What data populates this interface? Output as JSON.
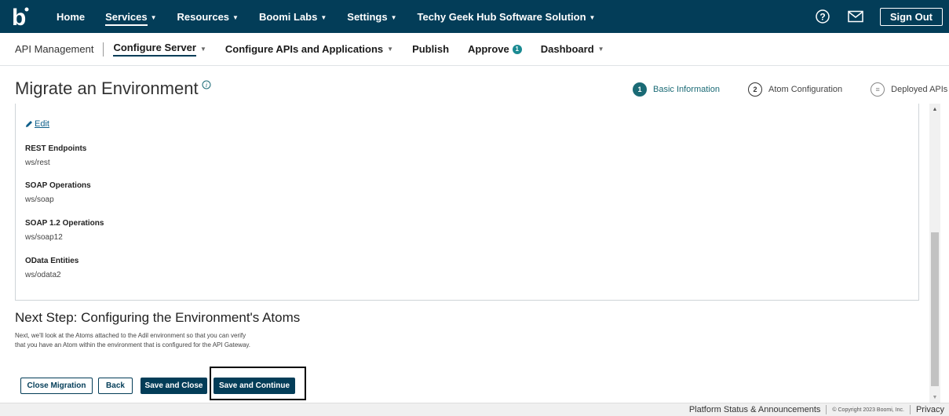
{
  "topnav": {
    "logo": "b",
    "links": [
      {
        "label": "Home",
        "caret": false
      },
      {
        "label": "Services",
        "caret": true
      },
      {
        "label": "Resources",
        "caret": true
      },
      {
        "label": "Boomi Labs",
        "caret": true
      },
      {
        "label": "Settings",
        "caret": true
      },
      {
        "label": "Techy Geek Hub Software Solution",
        "caret": true
      }
    ],
    "sign_out": "Sign Out",
    "icons": [
      "help-icon",
      "mail-icon"
    ]
  },
  "subnav": {
    "title": "API Management",
    "items": [
      {
        "label": "Configure Server",
        "caret": true
      },
      {
        "label": "Configure APIs and Applications",
        "caret": true
      },
      {
        "label": "Publish",
        "caret": false
      },
      {
        "label": "Approve",
        "caret": false,
        "badge": "1"
      },
      {
        "label": "Dashboard",
        "caret": true
      }
    ]
  },
  "page": {
    "title": "Migrate an Environment"
  },
  "steps": [
    {
      "number": "1",
      "label": "Basic Information",
      "state": "active"
    },
    {
      "number": "2",
      "label": "Atom Configuration",
      "state": "pending"
    },
    {
      "number": "≡",
      "label": "Deployed APIs",
      "state": "pending"
    }
  ],
  "panel": {
    "edit_label": "Edit",
    "fields": [
      {
        "label": "REST Endpoints",
        "value": "ws/rest"
      },
      {
        "label": "SOAP Operations",
        "value": "ws/soap"
      },
      {
        "label": "SOAP 1.2 Operations",
        "value": "ws/soap12"
      },
      {
        "label": "OData Entities",
        "value": "ws/odata2"
      }
    ]
  },
  "next_step": {
    "heading": "Next Step: Configuring the Environment's Atoms",
    "line1": "Next, we'll look at the Atoms attached to the Adil environment so that you can verify",
    "line2": "that you have an Atom within the environment that is configured for the API Gateway."
  },
  "buttons": {
    "close_migration": "Close Migration",
    "back": "Back",
    "save_and_close": "Save and Close",
    "save_and_continue": "Save and Continue"
  },
  "footer": {
    "status": "Platform Status & Announcements",
    "copyright": "© Copyright 2023 Boomi, Inc.",
    "privacy": "Privacy"
  },
  "colors": {
    "brand_navy": "#033d58",
    "step_active": "#1a6a75",
    "badge_teal": "#1a8a92",
    "link_blue": "#0e5f8a"
  }
}
